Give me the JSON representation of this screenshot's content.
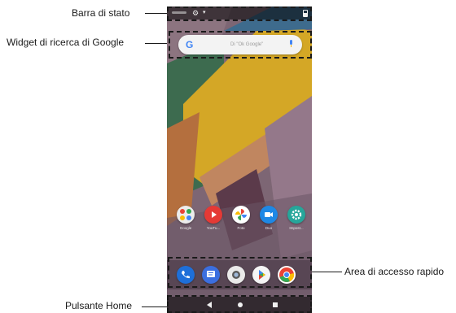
{
  "callouts": {
    "status_bar": "Barra di stato",
    "google_widget": "Widget di ricerca di Google",
    "quick_access": "Area di accesso rapido",
    "home_button": "Pulsante Home"
  },
  "phone": {
    "search": {
      "placeholder": "Di \"Ok Google\""
    },
    "apps": [
      {
        "label": "Google",
        "icon": "google-folder-icon"
      },
      {
        "label": "YouTu...",
        "icon": "youtube-icon"
      },
      {
        "label": "Foto",
        "icon": "photos-icon"
      },
      {
        "label": "Duo",
        "icon": "duo-icon"
      },
      {
        "label": "Impost...",
        "icon": "settings-icon"
      }
    ],
    "dock": [
      "phone-icon",
      "messages-icon",
      "camera-icon",
      "play-store-icon",
      "chrome-icon"
    ]
  },
  "colors": {
    "youtube": "#e53935",
    "duo": "#1e88e5",
    "settings": "#26a69a",
    "phone": "#1e6fd9",
    "messages": "#3b6fe0"
  }
}
